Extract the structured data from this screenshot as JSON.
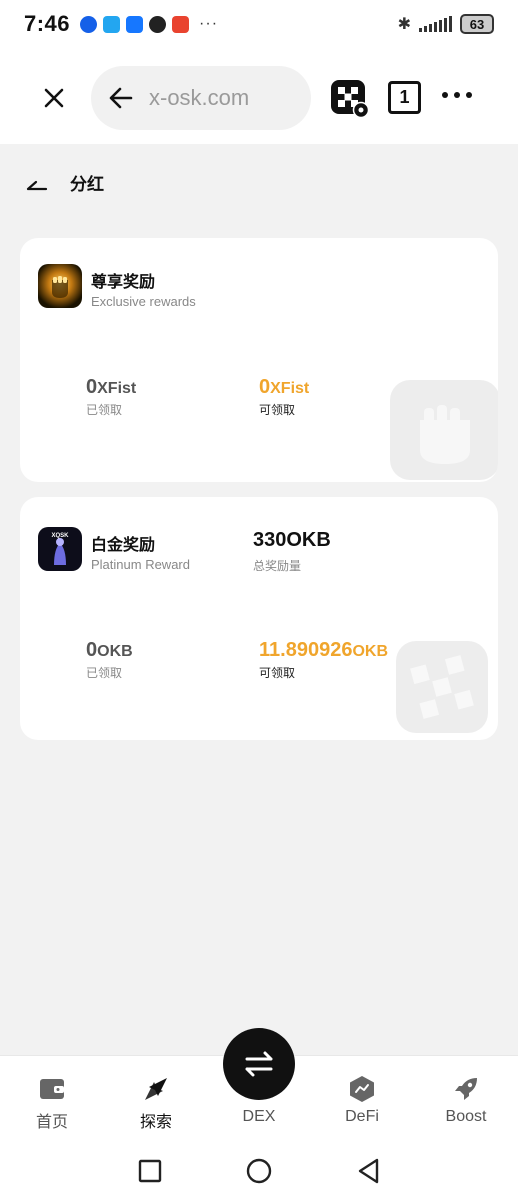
{
  "status_bar": {
    "time": "7:46",
    "more": "···",
    "battery": "63"
  },
  "browser": {
    "url": "x-osk.com",
    "tab_count": "1"
  },
  "page": {
    "title": "分红"
  },
  "cards": [
    {
      "title": "尊享奖励",
      "subtitle": "Exclusive rewards",
      "claimed_amount": "0",
      "claimed_unit": "XFist",
      "claimed_label": "已领取",
      "claimable_amount": "0",
      "claimable_unit": "XFist",
      "claimable_label": "可领取"
    },
    {
      "title": "白金奖励",
      "subtitle": "Platinum Reward",
      "logo_text": "XQSK",
      "total_amount": "330OKB",
      "total_label": "总奖励量",
      "claimed_amount": "0",
      "claimed_unit": "OKB",
      "claimed_label": "已领取",
      "claimable_amount": "11.890926",
      "claimable_unit": "OKB",
      "claimable_label": "可领取"
    }
  ],
  "bottom_nav": {
    "items": [
      {
        "label": "首页",
        "icon": "wallet-icon"
      },
      {
        "label": "探索",
        "icon": "compass-icon"
      },
      {
        "label": "DEX",
        "icon": "swap-icon"
      },
      {
        "label": "DeFi",
        "icon": "defi-icon"
      },
      {
        "label": "Boost",
        "icon": "rocket-icon"
      }
    ]
  },
  "colors": {
    "accent_gold": "#f0a52c",
    "background": "#f2f2f2",
    "card": "#ffffff"
  }
}
